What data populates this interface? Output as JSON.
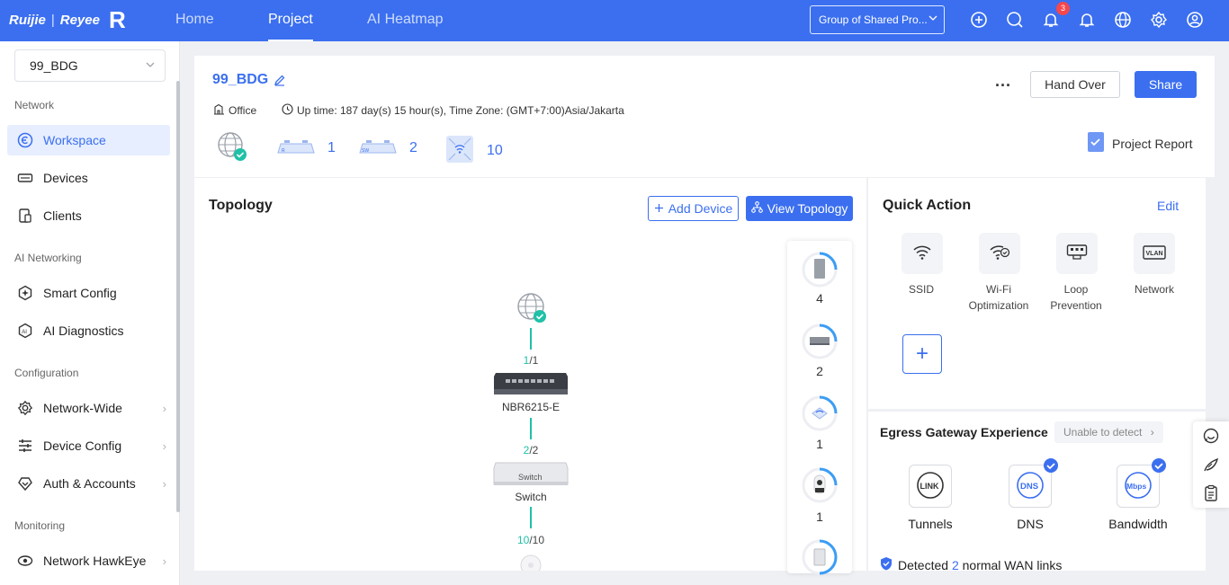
{
  "header": {
    "brand_left": "Ruijie",
    "brand_right": "Reyee",
    "brand_sep": "|",
    "tabs": [
      "Home",
      "Project",
      "AI Heatmap"
    ],
    "active_tab": "Project",
    "group_selector": "Group of Shared Pro...",
    "notification_count": "3",
    "icons": [
      "add-circle-icon",
      "search-icon",
      "bell-icon",
      "alert-bell-icon",
      "globe-icon",
      "gear-icon",
      "user-icon"
    ]
  },
  "sidebar": {
    "site": "99_BDG",
    "sections": {
      "network": "Network",
      "ai_networking": "AI Networking",
      "configuration": "Configuration",
      "monitoring": "Monitoring"
    },
    "items": {
      "workspace": "Workspace",
      "devices": "Devices",
      "clients": "Clients",
      "smart_config": "Smart Config",
      "ai_diagnostics": "AI Diagnostics",
      "network_wide": "Network-Wide",
      "device_config": "Device Config",
      "auth_accounts": "Auth & Accounts",
      "network_hawkeye": "Network HawkEye"
    }
  },
  "project": {
    "name": "99_BDG",
    "scene": "Office",
    "uptime": "Up time: 187 day(s) 15 hour(s), Time Zone: (GMT+7:00)Asia/Jakarta",
    "more": "···",
    "hand_over": "Hand Over",
    "share": "Share",
    "report": "Project Report",
    "counts": {
      "gateway": "1",
      "switch": "2",
      "ap": "10"
    },
    "device_tags": {
      "gateway": "R",
      "switch": "SW"
    }
  },
  "topology": {
    "title": "Topology",
    "add_device": "Add Device",
    "view_topology": "View Topology",
    "gateway_ratio_ok": "1",
    "gateway_ratio_total": "/1",
    "gateway_name": "NBR6215-E",
    "switch_ratio_ok": "2",
    "switch_ratio_total": "/2",
    "switch_name": "Switch",
    "switch_face_label": "Switch",
    "ap_ratio_ok": "10",
    "ap_ratio_total": "/10",
    "rail_counts": [
      "4",
      "2",
      "1",
      "1"
    ]
  },
  "quick_action": {
    "title": "Quick Action",
    "edit": "Edit",
    "items": [
      "SSID",
      "Wi-Fi\nOptimization",
      "Loop\nPrevention",
      "Network"
    ],
    "vlan_tag": "VLAN",
    "add": "+"
  },
  "egress": {
    "title": "Egress Gateway Experience",
    "status": "Unable to detect",
    "status_arrow": "›",
    "items": [
      "Tunnels",
      "DNS",
      "Bandwidth"
    ],
    "icon_text": [
      "LINK",
      "DNS",
      "Mbps"
    ],
    "detected_prefix": "Detected",
    "detected_count": "2",
    "detected_suffix": "normal WAN links"
  },
  "colors": {
    "accent": "#3b6ff0",
    "ok": "#1fc1a7",
    "badge": "#f5474c"
  }
}
